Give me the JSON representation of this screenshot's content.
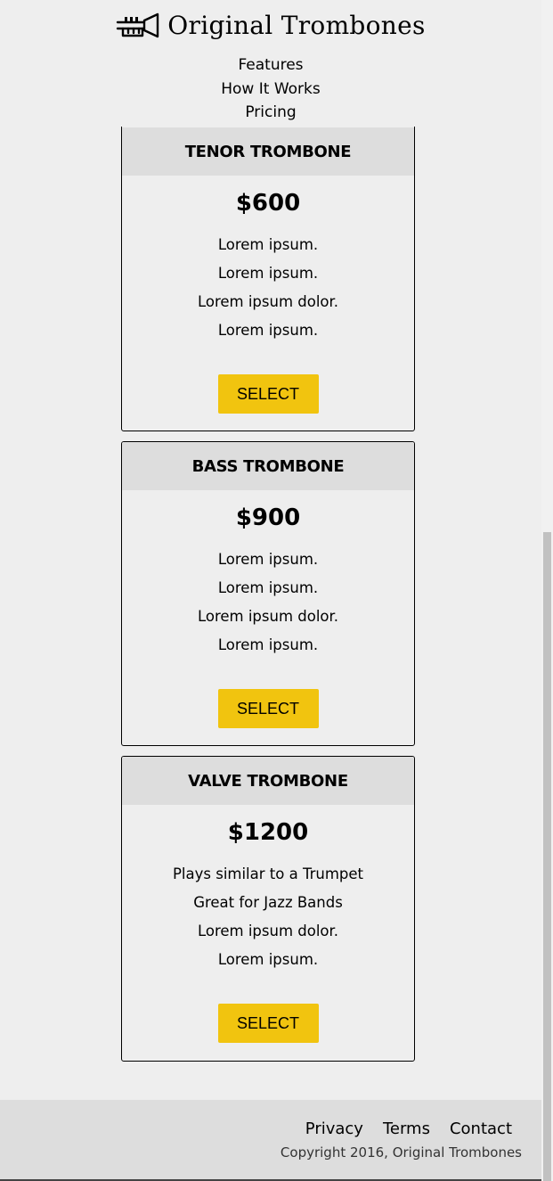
{
  "brand": {
    "name": "Original Trombones",
    "logo_icon": "trombone-icon"
  },
  "nav": [
    {
      "label": "Features"
    },
    {
      "label": "How It Works"
    },
    {
      "label": "Pricing"
    }
  ],
  "plans": [
    {
      "title": "TENOR TROMBONE",
      "price": "$600",
      "features": [
        "Lorem ipsum.",
        "Lorem ipsum.",
        "Lorem ipsum dolor.",
        "Lorem ipsum."
      ],
      "button": "SELECT"
    },
    {
      "title": "BASS TROMBONE",
      "price": "$900",
      "features": [
        "Lorem ipsum.",
        "Lorem ipsum.",
        "Lorem ipsum dolor.",
        "Lorem ipsum."
      ],
      "button": "SELECT"
    },
    {
      "title": "VALVE TROMBONE",
      "price": "$1200",
      "features": [
        "Plays similar to a Trumpet",
        "Great for Jazz Bands",
        "Lorem ipsum dolor.",
        "Lorem ipsum."
      ],
      "button": "SELECT"
    }
  ],
  "footer": {
    "links": [
      {
        "label": "Privacy"
      },
      {
        "label": "Terms"
      },
      {
        "label": "Contact"
      }
    ],
    "copyright": "Copyright 2016, Original Trombones"
  },
  "colors": {
    "accent": "#f1c40f",
    "background": "#eeeeee",
    "panel": "#dddddd"
  }
}
